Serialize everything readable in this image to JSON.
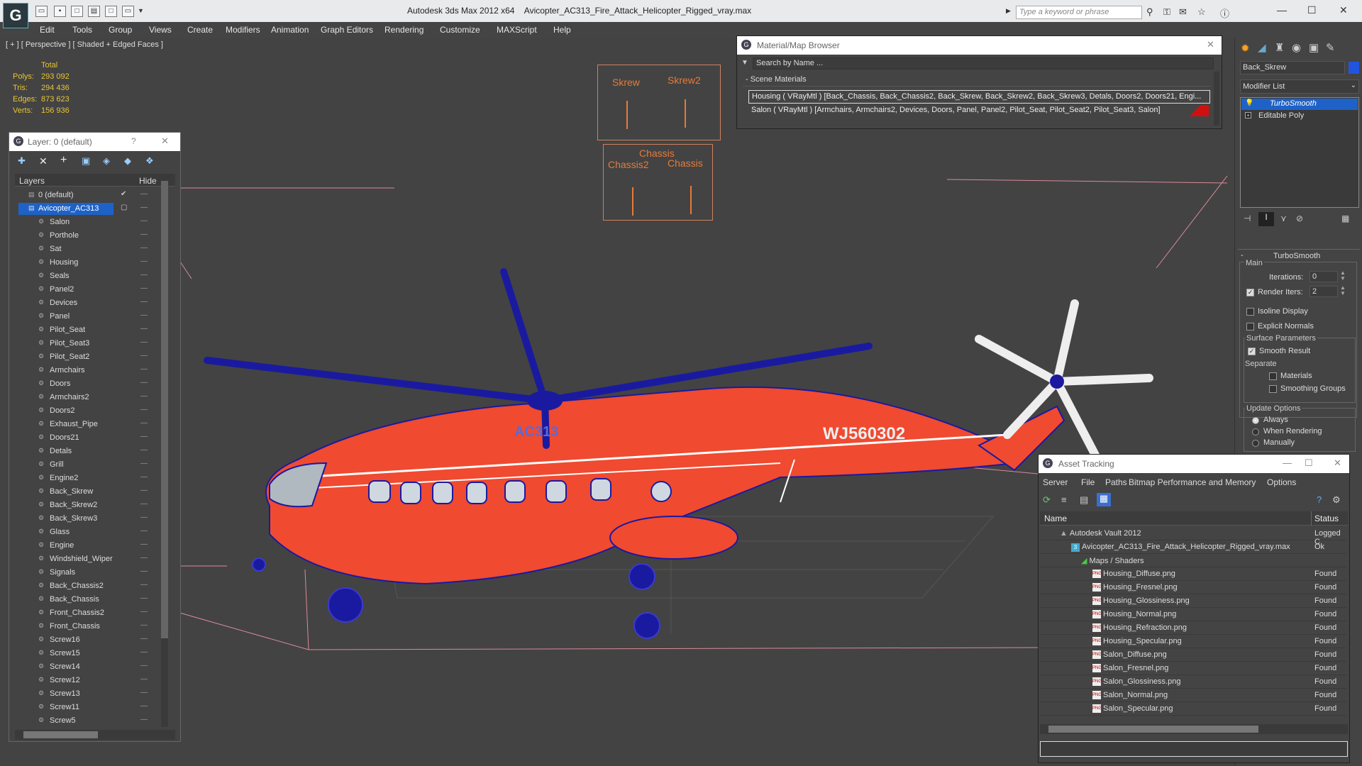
{
  "titlebar": {
    "app_name": "Autodesk 3ds Max  2012 x64",
    "file_name": "Avicopter_AC313_Fire_Attack_Helicopter_Rigged_vray.max",
    "search_placeholder": "Type a keyword or phrase"
  },
  "menu": [
    "Edit",
    "Tools",
    "Group",
    "Views",
    "Create",
    "Modifiers",
    "Animation",
    "Graph Editors",
    "Rendering",
    "Customize",
    "MAXScript",
    "Help"
  ],
  "viewport": {
    "label": "[ + ] [ Perspective ] [ Shaded + Edged Faces ]",
    "stats_header": "Total",
    "stats": [
      {
        "label": "Polys:",
        "value": "293 092"
      },
      {
        "label": "Tris:",
        "value": "294 436"
      },
      {
        "label": "Edges:",
        "value": "873 623"
      },
      {
        "label": "Verts:",
        "value": "156 936"
      }
    ],
    "rig": {
      "skrew": "Skrew",
      "skrew2": "Skrew2",
      "chassis": "Chassis",
      "chassis2": "Chassis2",
      "chassis_b": "Chassis"
    },
    "heli_text1": "AC313",
    "heli_text2": "WJ560302"
  },
  "layer_panel": {
    "title": "Layer: 0 (default)",
    "help": "?",
    "col_layers": "Layers",
    "col_hide": "Hide",
    "default_layer": "0 (default)",
    "main_layer": "Avicopter_AC313",
    "items": [
      "Salon",
      "Porthole",
      "Sat",
      "Housing",
      "Seals",
      "Panel2",
      "Devices",
      "Panel",
      "Pilot_Seat",
      "Pilot_Seat3",
      "Pilot_Seat2",
      "Armchairs",
      "Doors",
      "Armchairs2",
      "Doors2",
      "Exhaust_Pipe",
      "Doors21",
      "Detals",
      "Grill",
      "Engine2",
      "Back_Skrew",
      "Back_Skrew2",
      "Back_Skrew3",
      "Glass",
      "Engine",
      "Windshield_Wiper",
      "Signals",
      "Back_Chassis2",
      "Back_Chassis",
      "Front_Chassis2",
      "Front_Chassis",
      "Screw16",
      "Screw15",
      "Screw14",
      "Screw12",
      "Screw13",
      "Screw11",
      "Screw5"
    ]
  },
  "material_browser": {
    "title": "Material/Map Browser",
    "search": "Search by Name ...",
    "group": "- Scene Materials",
    "rows": [
      "Housing  ( VRayMtl ) [Back_Chassis, Back_Chassis2, Back_Skrew, Back_Skrew2, Back_Skrew3, Detals, Doors2, Doors21, Engi...",
      "Salon  ( VRayMtl ) [Armchairs, Armchairs2, Devices, Doors, Panel, Panel2, Pilot_Seat, Pilot_Seat2, Pilot_Seat3, Salon]"
    ]
  },
  "command_panel": {
    "object_name": "Back_Skrew",
    "modifier_list": "Modifier List",
    "stack": [
      "TurboSmooth",
      "Editable Poly"
    ],
    "rollout": "TurboSmooth",
    "main": "Main",
    "iterations_label": "Iterations:",
    "iterations_value": "0",
    "render_iters_label": "Render Iters:",
    "render_iters_value": "2",
    "isoline": "Isoline Display",
    "explicit": "Explicit Normals",
    "surface_params": "Surface Parameters",
    "smooth_result": "Smooth Result",
    "separate": "Separate",
    "materials": "Materials",
    "smoothing_groups": "Smoothing Groups",
    "update_options": "Update Options",
    "always": "Always",
    "when_rendering": "When Rendering",
    "manually": "Manually"
  },
  "asset_tracking": {
    "title": "Asset Tracking",
    "menu": [
      "Server",
      "File",
      "Paths",
      "Bitmap Performance and Memory",
      "Options"
    ],
    "col_name": "Name",
    "col_status": "Status",
    "rows": [
      {
        "name": "Autodesk Vault 2012",
        "status": "Logged C",
        "indent": 0
      },
      {
        "name": "Avicopter_AC313_Fire_Attack_Helicopter_Rigged_vray.max",
        "status": "Ok",
        "indent": 1
      },
      {
        "name": "Maps / Shaders",
        "status": "",
        "indent": 2
      },
      {
        "name": "Housing_Diffuse.png",
        "status": "Found",
        "indent": 3
      },
      {
        "name": "Housing_Fresnel.png",
        "status": "Found",
        "indent": 3
      },
      {
        "name": "Housing_Glossiness.png",
        "status": "Found",
        "indent": 3
      },
      {
        "name": "Housing_Normal.png",
        "status": "Found",
        "indent": 3
      },
      {
        "name": "Housing_Refraction.png",
        "status": "Found",
        "indent": 3
      },
      {
        "name": "Housing_Specular.png",
        "status": "Found",
        "indent": 3
      },
      {
        "name": "Salon_Diffuse.png",
        "status": "Found",
        "indent": 3
      },
      {
        "name": "Salon_Fresnel.png",
        "status": "Found",
        "indent": 3
      },
      {
        "name": "Salon_Glossiness.png",
        "status": "Found",
        "indent": 3
      },
      {
        "name": "Salon_Normal.png",
        "status": "Found",
        "indent": 3
      },
      {
        "name": "Salon_Specular.png",
        "status": "Found",
        "indent": 3
      }
    ]
  }
}
